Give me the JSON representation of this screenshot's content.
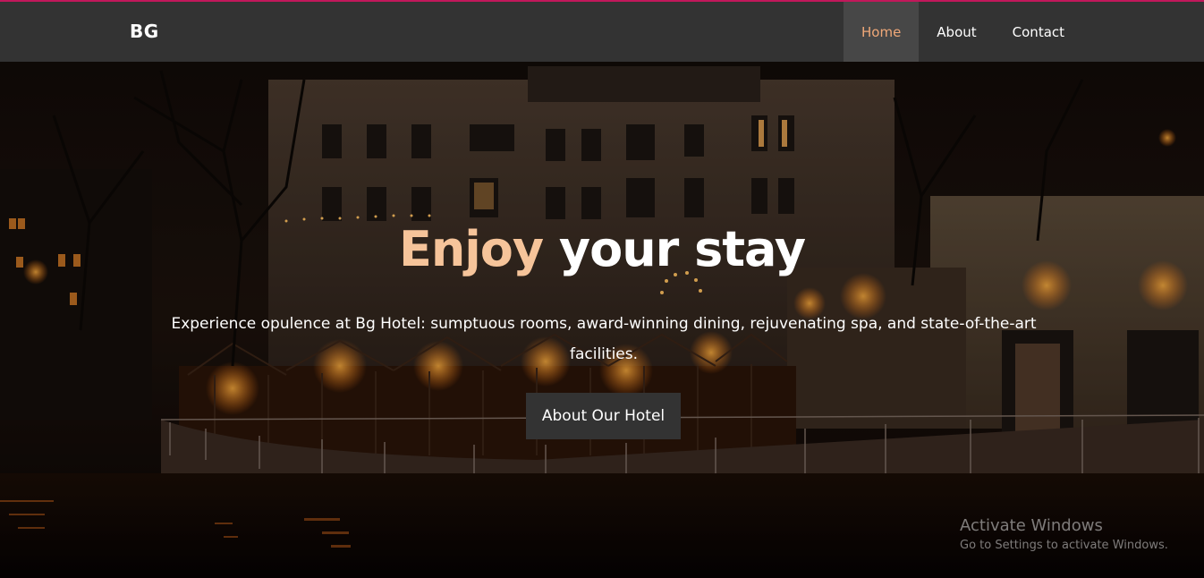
{
  "topline_color": "#c2185b",
  "nav": {
    "brand": "BG",
    "links": [
      {
        "label": "Home",
        "active": true
      },
      {
        "label": "About",
        "active": false
      },
      {
        "label": "Contact",
        "active": false
      }
    ],
    "active_color": "#f0a878"
  },
  "hero": {
    "title_accent": "Enjoy",
    "title_rest": " your stay",
    "subtitle": "Experience opulence at Bg Hotel: sumptuous rooms, award-winning dining, rejuvenating spa, and state-of-the-art facilities.",
    "button": "About Our Hotel",
    "accent_color": "#f6c49a"
  },
  "watermark": {
    "title": "Activate Windows",
    "subtitle": "Go to Settings to activate Windows."
  }
}
